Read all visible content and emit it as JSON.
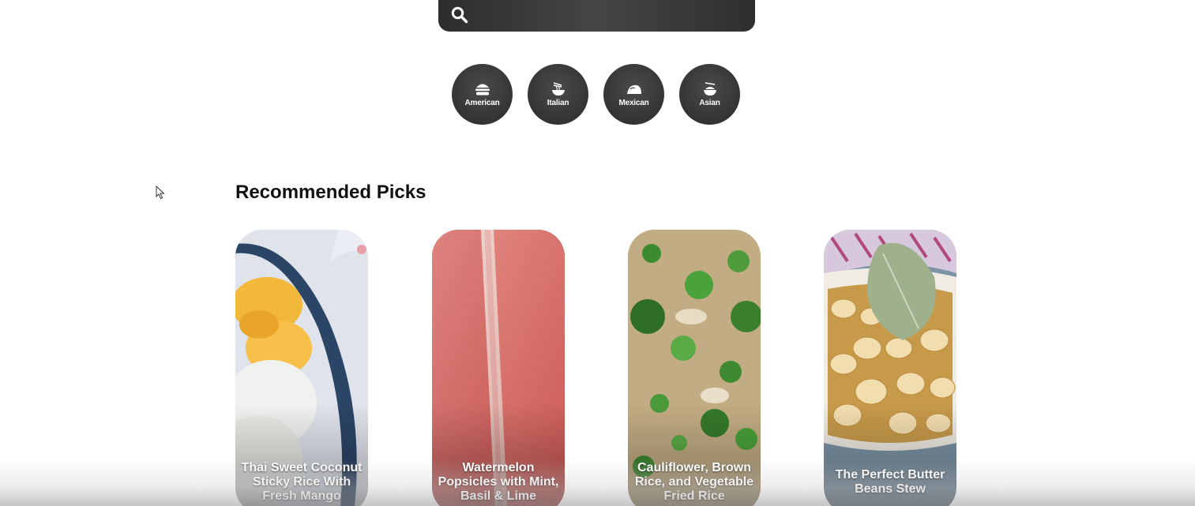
{
  "search": {
    "placeholder": "",
    "icon": "search-icon"
  },
  "cuisines": [
    {
      "label": "American",
      "icon": "burger-icon"
    },
    {
      "label": "Italian",
      "icon": "noodle-bowl-icon"
    },
    {
      "label": "Mexican",
      "icon": "taco-icon"
    },
    {
      "label": "Asian",
      "icon": "rice-bowl-icon"
    }
  ],
  "recommended": {
    "title": "Recommended Picks",
    "cards": [
      {
        "line1": "Thai Sweet Coconut",
        "line2": "Sticky Rice With",
        "line3": "Fresh Mango"
      },
      {
        "line1": "Watermelon",
        "line2": "Popsicles with Mint,",
        "line3": "Basil & Lime"
      },
      {
        "line1": "Cauliflower, Brown",
        "line2": "Rice, and Vegetable",
        "line3": "Fried Rice"
      },
      {
        "line1": "The Perfect Butter",
        "line2": "Beans Stew",
        "line3": ""
      }
    ]
  },
  "colors": {
    "dark": "#333333",
    "text": "#111111",
    "white": "#ffffff"
  }
}
